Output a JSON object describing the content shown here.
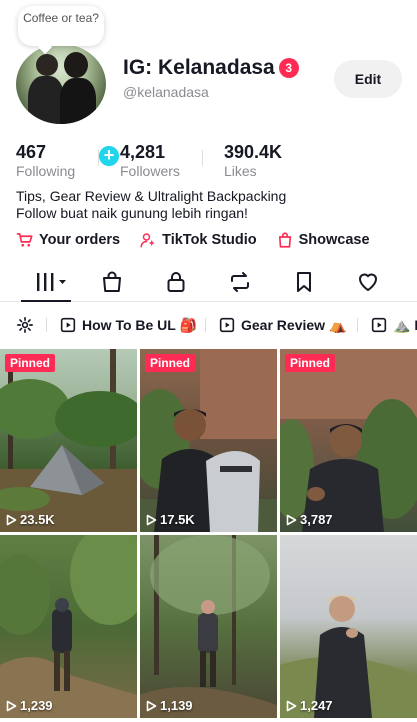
{
  "profile": {
    "note_bubble": "Coffee or tea?",
    "display_name": "IG: Kelanadasa",
    "notification_count": "3",
    "username": "@kelanadasa",
    "edit_label": "Edit",
    "add_symbol": "+"
  },
  "stats": [
    {
      "value": "467",
      "label": "Following"
    },
    {
      "value": "4,281",
      "label": "Followers"
    },
    {
      "value": "390.4K",
      "label": "Likes"
    }
  ],
  "bio": {
    "line1": "Tips, Gear Review & Ultralight Backpacking",
    "line2": "Follow buat naik gunung lebih ringan!"
  },
  "quick_links": [
    {
      "label": "Your orders",
      "icon": "cart-icon"
    },
    {
      "label": "TikTok Studio",
      "icon": "person-sparkle-icon"
    },
    {
      "label": "Showcase",
      "icon": "shopping-bag-icon"
    }
  ],
  "tabs": [
    {
      "name": "videos",
      "icon": "grid-menu-icon",
      "active": true
    },
    {
      "name": "shop",
      "icon": "bag-icon"
    },
    {
      "name": "private",
      "icon": "lock-icon"
    },
    {
      "name": "reposts",
      "icon": "repost-icon"
    },
    {
      "name": "favorites",
      "icon": "bookmark-icon"
    },
    {
      "name": "liked",
      "icon": "heart-icon"
    }
  ],
  "playlists": [
    {
      "label": "How To Be UL 🎒"
    },
    {
      "label": "Gear Review ⛺"
    },
    {
      "label": "⛰️ L"
    }
  ],
  "videos": [
    {
      "pinned": true,
      "pinned_label": "Pinned",
      "views": "23.5K",
      "scene": "tent-forest"
    },
    {
      "pinned": true,
      "pinned_label": "Pinned",
      "views": "17.5K",
      "scene": "hiker-backpack"
    },
    {
      "pinned": true,
      "pinned_label": "Pinned",
      "views": "3,787",
      "scene": "hiker-talking"
    },
    {
      "pinned": false,
      "views": "1,239",
      "scene": "trail-walk"
    },
    {
      "pinned": false,
      "views": "1,139",
      "scene": "forest-path"
    },
    {
      "pinned": false,
      "views": "1,247",
      "scene": "mountain-ridge"
    }
  ],
  "colors": {
    "accent": "#fe2c55",
    "add_button": "#20d5ec",
    "text": "#161823",
    "secondary_text": "#8a8b91"
  }
}
